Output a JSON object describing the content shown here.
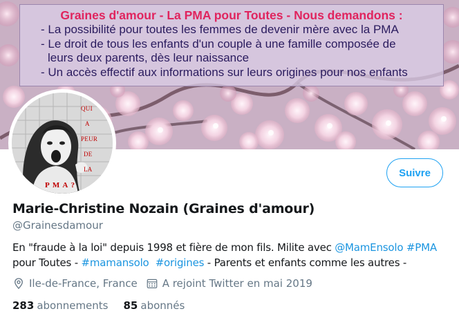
{
  "banner": {
    "title": "Graines d'amour - La PMA pour Toutes - Nous demandons :",
    "lines": [
      "- La possibilité pour toutes les femmes de devenir mère avec la PMA",
      "- Le droit de tous les enfants d'un couple à une famille composée de",
      "leurs deux parents, dès leur naissance",
      "- Un accès effectif aux informations sur leurs origines pour nos enfants"
    ],
    "title_color": "#e0245e",
    "text_color": "#2a1b5e"
  },
  "avatar": {
    "words": [
      "QUI",
      "A",
      "PEUR",
      "DE",
      "LA"
    ],
    "bottom": "P M A ?"
  },
  "follow_button": {
    "label": "Suivre",
    "color": "#1da1f2"
  },
  "profile": {
    "name": "Marie-Christine Nozain (Graines d'amour)",
    "handle": "@Grainesdamour",
    "bio": {
      "part1": "En \"fraude à la loi\" depuis 1998 et fière de mon fils. Milite avec ",
      "mention": "@MamEnsolo",
      "space1": " ",
      "hashtag1": "#PMA",
      "part2": "pour Toutes - ",
      "hashtag2": "#mamansolo",
      "space2": "  ",
      "hashtag3": "#origines",
      "part3": " - Parents et enfants comme les autres -"
    },
    "location": "Ile-de-France, France",
    "location_icon": "location-pin-icon",
    "joined": "A rejoint Twitter en mai 2019",
    "joined_icon": "calendar-icon",
    "link_color": "#1b95e0"
  },
  "stats": {
    "following_count": "283",
    "following_label": "abonnements",
    "followers_count": "85",
    "followers_label": "abonnés"
  }
}
